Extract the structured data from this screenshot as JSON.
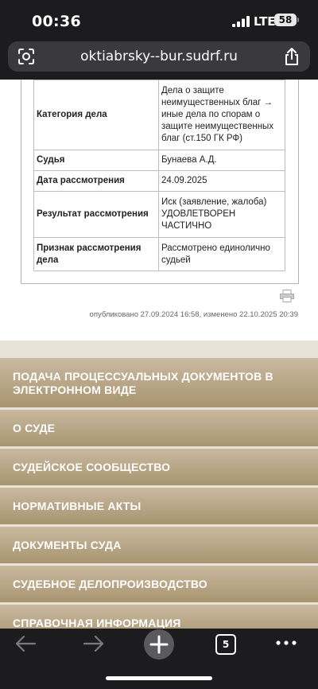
{
  "status": {
    "time": "00:36",
    "network": "LTE",
    "battery": "58"
  },
  "browser": {
    "url": "oktiabrsky--bur.sudrf.ru",
    "tab_count": "5"
  },
  "case_table": [
    {
      "label": "Категория дела",
      "value": "Дела о защите неимущественных благ → иные дела по спорам о защите неимущественных благ (ст.150 ГК РФ)"
    },
    {
      "label": "Судья",
      "value": "Бунаева А.Д."
    },
    {
      "label": "Дата рассмотрения",
      "value": "24.09.2025"
    },
    {
      "label": "Результат рассмотрения",
      "value": "Иск (заявление, жалоба) УДОВЛЕТВОРЕН ЧАСТИЧНО"
    },
    {
      "label": "Признак рассмотрения дела",
      "value": "Рассмотрено единолично судьей"
    }
  ],
  "published": "опубликовано 27.09.2024 16:58, изменено 22.10.2025 20:39",
  "menu": [
    "ПОДАЧА ПРОЦЕССУАЛЬНЫХ ДОКУМЕНТОВ В ЭЛЕКТРОННОМ ВИДЕ",
    "О СУДЕ",
    "СУДЕЙСКОЕ СООБЩЕСТВО",
    "НОРМАТИВНЫЕ АКТЫ",
    "ДОКУМЕНТЫ СУДА",
    "СУДЕБНОЕ ДЕЛОПРОИЗВОДСТВО",
    "СПРАВОЧНАЯ ИНФОРМАЦИЯ"
  ]
}
